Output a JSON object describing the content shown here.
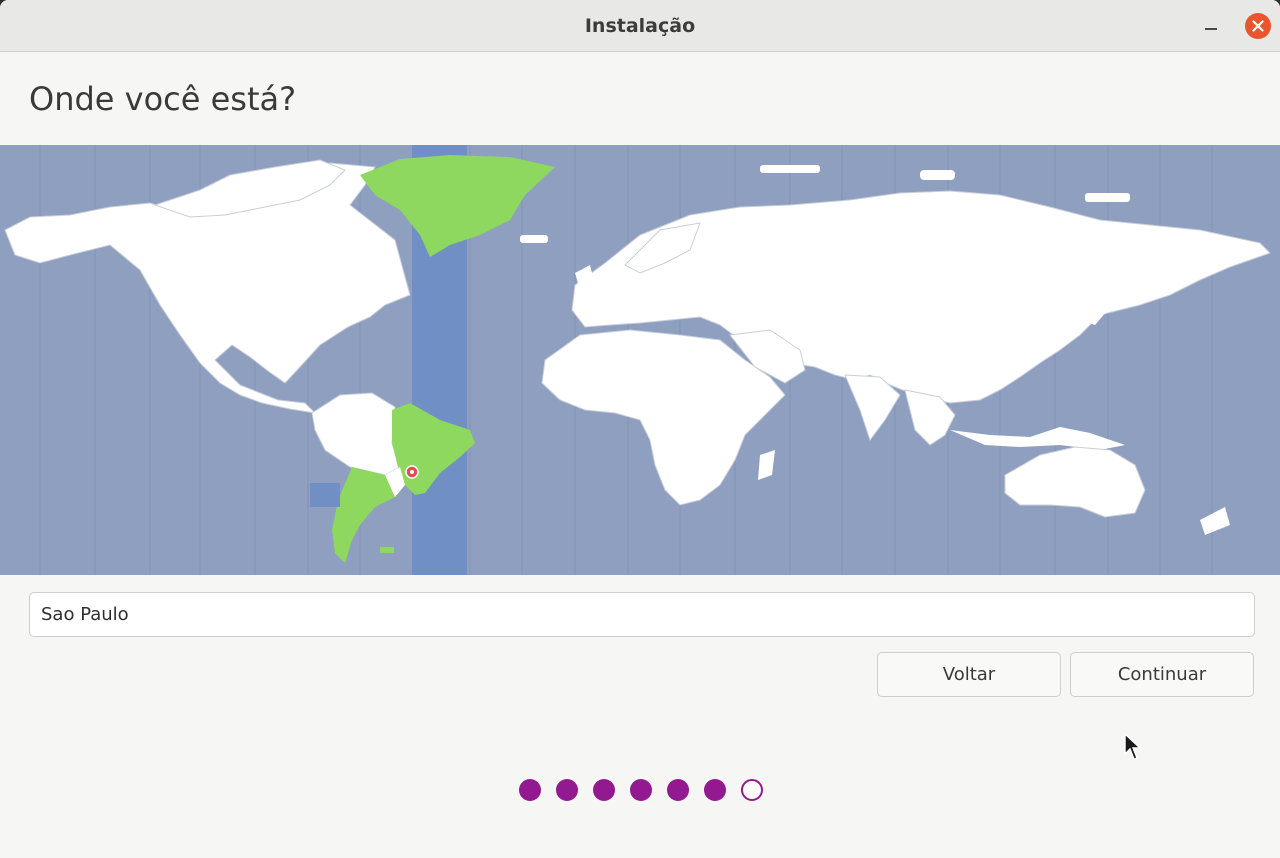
{
  "window": {
    "title": "Instalação"
  },
  "page": {
    "heading": "Onde você está?"
  },
  "timezone": {
    "city_value": "Sao Paulo",
    "selected_region": "America/Sao_Paulo"
  },
  "buttons": {
    "back_label": "Voltar",
    "continue_label": "Continuar"
  },
  "progress": {
    "total_steps": 7,
    "completed_steps": 6
  },
  "colors": {
    "accent": "#92198f",
    "ocean": "#8e9fbf",
    "land": "#ffffff",
    "highlight_land": "#8ed85f",
    "highlight_band": "#6f8fc5",
    "close": "#e9552f"
  },
  "icons": {
    "close": "close-icon",
    "minimize": "minimize-icon",
    "location_pin": "location-pin-icon",
    "mouse_cursor": "mouse-cursor-icon"
  }
}
